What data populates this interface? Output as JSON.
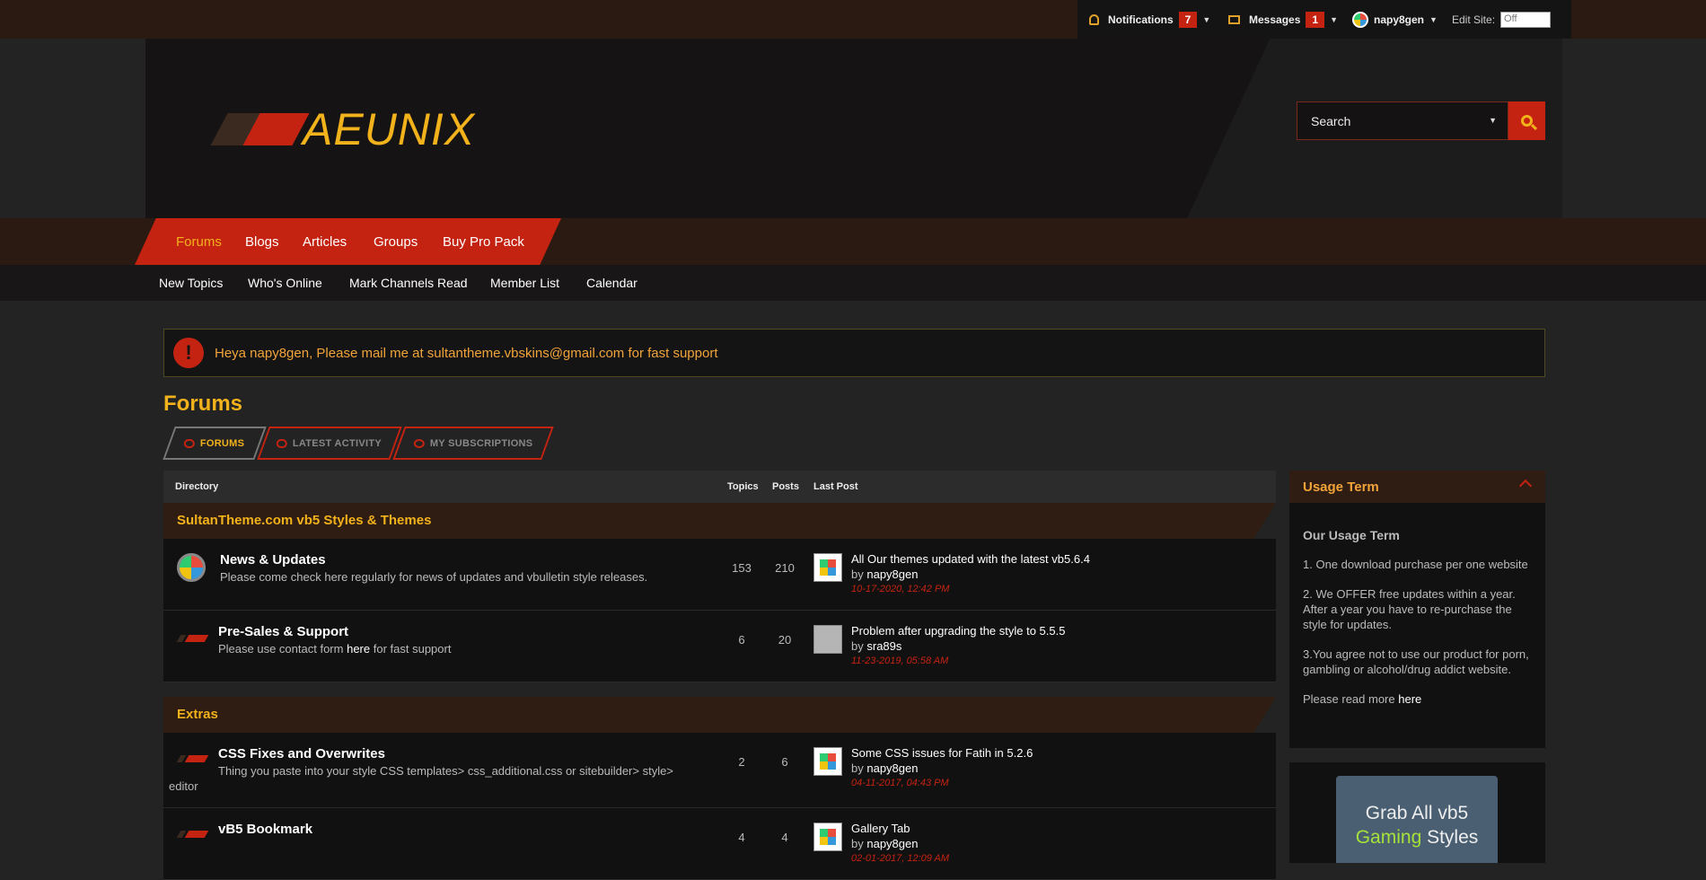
{
  "topbar": {
    "notifications_label": "Notifications",
    "notifications_count": "7",
    "messages_label": "Messages",
    "messages_count": "1",
    "username": "napy8gen",
    "edit_site_label": "Edit Site:",
    "edit_site_toggle": "Off"
  },
  "header": {
    "logo_text": "AEUNIX",
    "search_placeholder": "Search"
  },
  "nav": [
    "Forums",
    "Blogs",
    "Articles",
    "Groups",
    "Buy Pro Pack"
  ],
  "subnav": [
    "New Topics",
    "Who's Online",
    "Mark Channels Read",
    "Member List",
    "Calendar"
  ],
  "alert": {
    "text": "Heya napy8gen, Please mail me at sultantheme.vbskins@gmail.com for fast support"
  },
  "page_title": "Forums",
  "tabs": [
    "FORUMS",
    "LATEST ACTIVITY",
    "MY SUBSCRIPTIONS"
  ],
  "table": {
    "headers": {
      "directory": "Directory",
      "topics": "Topics",
      "posts": "Posts",
      "last_post": "Last Post"
    },
    "categories": [
      {
        "title": "SultanTheme.com vb5 Styles & Themes",
        "forums": [
          {
            "title": "News & Updates",
            "desc": "Please come check here regularly for news of updates and vbulletin style releases.",
            "topics": "153",
            "posts": "210",
            "lp_title": "All Our themes updated with the latest vb5.6.4",
            "lp_by": "by",
            "lp_user": "napy8gen",
            "lp_date": "10-17-2020, 12:42 PM"
          },
          {
            "title": "Pre-Sales & Support",
            "desc_pre": "Please use contact form",
            "desc_link": "here",
            "desc_post": "for fast support",
            "topics": "6",
            "posts": "20",
            "lp_title": "Problem after upgrading the style to 5.5.5",
            "lp_by": "by",
            "lp_user": "sra89s",
            "lp_date": "11-23-2019, 05:58 AM"
          }
        ]
      },
      {
        "title": "Extras",
        "forums": [
          {
            "title": "CSS Fixes and Overwrites",
            "desc_1": "Thing you paste into your style CSS templates> css_additional.css or sitebuilder> style>",
            "desc_2": "editor",
            "topics": "2",
            "posts": "6",
            "lp_title": "Some CSS issues for Fatih in 5.2.6",
            "lp_by": "by",
            "lp_user": "napy8gen",
            "lp_date": "04-11-2017, 04:43 PM"
          },
          {
            "title": "vB5 Bookmark",
            "topics": "4",
            "posts": "4",
            "lp_title": "Gallery Tab",
            "lp_by": "by",
            "lp_user": "napy8gen",
            "lp_date": "02-01-2017, 12:09 AM"
          }
        ]
      }
    ]
  },
  "sidebar": {
    "usage_title": "Usage Term",
    "usage_heading": "Our Usage Term",
    "terms": [
      "1. One download purchase per one website",
      "2. We OFFER free updates within a year. After a year you have to re-purchase the style for updates.",
      "3.You agree not to use our product for porn, gambling or alcohol/drug addict website."
    ],
    "read_more_pre": "Please read more",
    "read_more_link": "here",
    "promo_line1": "Grab All vb5",
    "promo_line2_accent": "Gaming",
    "promo_line2_rest": "Styles"
  },
  "colors": {
    "accent_red": "#c52311",
    "accent_gold": "#f2b21b",
    "background": "#232323"
  }
}
